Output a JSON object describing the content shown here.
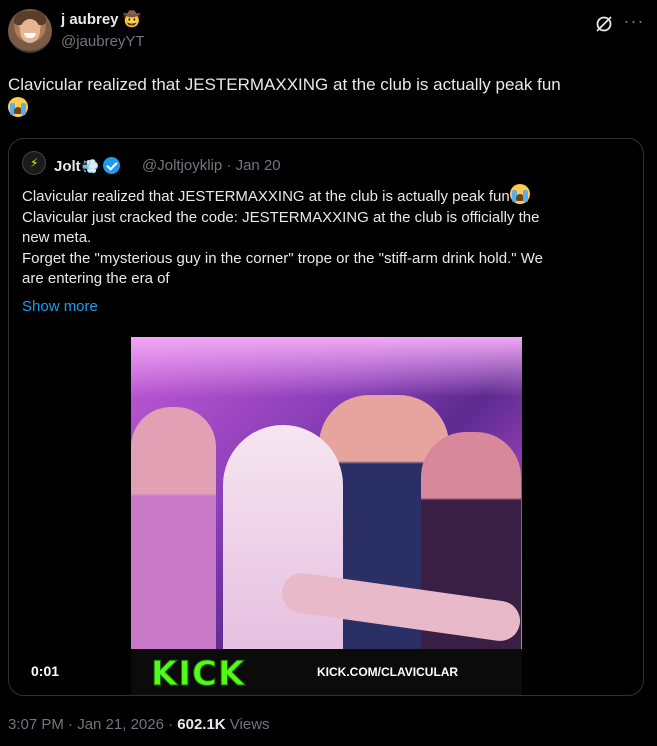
{
  "author": {
    "display_name": "j aubrey",
    "name_emoji": "🤠",
    "handle": "@jaubreyYT"
  },
  "tweet": {
    "text": "Clavicular realized that JESTERMAXXING at the club is actually peak fun"
  },
  "quoted": {
    "display_name": "Jolt",
    "name_emoji": "💨",
    "handle_date": "@Joltjoyklip · Jan 20",
    "lines": [
      "Clavicular realized that JESTERMAXXING at the club is actually peak fun",
      "Clavicular just cracked the code: JESTERMAXXING at the club is officially the",
      "new meta.",
      "Forget the \"mysterious guy in the corner\" trope or the \"stiff-arm drink hold.\" We",
      "are entering the era of"
    ],
    "show_more": "Show more",
    "video": {
      "timestamp": "0:01",
      "logo_text": "KICK",
      "url_text": "KICK.COM/CLAVICULAR"
    }
  },
  "footer": {
    "time_date": "3:07 PM · Jan 21, 2026 · ",
    "views_count": "602.1K",
    "views_label": " Views"
  },
  "colors": {
    "verified": "#1d9bf0",
    "link": "#1d9bf0",
    "kick_green": "#53fc18"
  },
  "icons": [
    "grok-icon",
    "more-icon",
    "verified-badge-icon",
    "loudly-crying-face-emoji"
  ]
}
